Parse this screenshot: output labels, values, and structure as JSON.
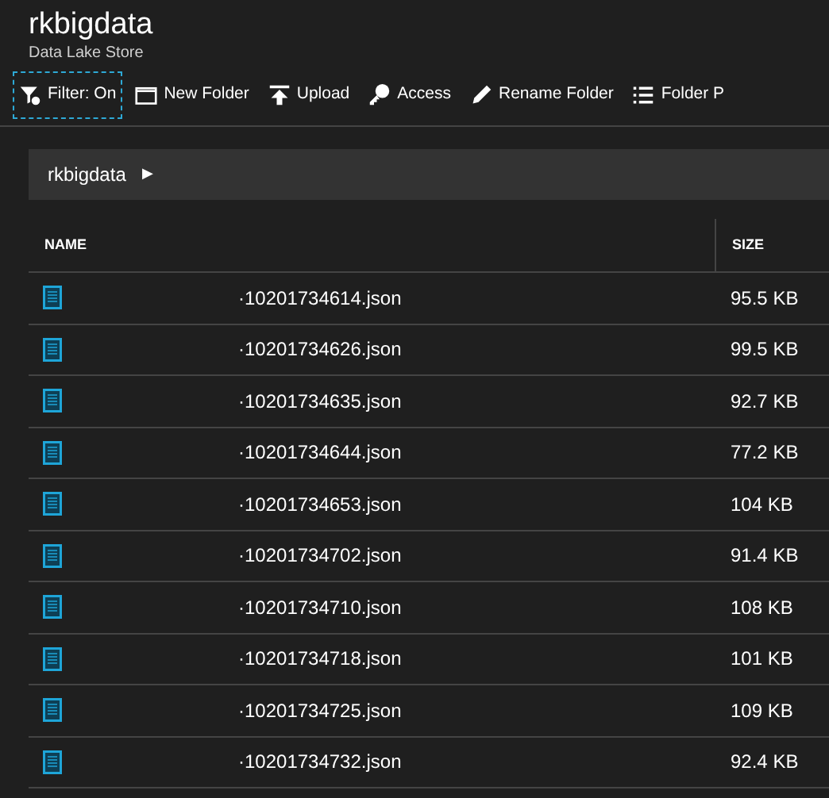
{
  "header": {
    "title": "rkbigdata",
    "subtitle": "Data Lake Store"
  },
  "toolbar": [
    {
      "kind": "filter",
      "label": "Filter: On",
      "focused": true
    },
    {
      "kind": "folder",
      "label": "New Folder",
      "focused": false
    },
    {
      "kind": "upload",
      "label": "Upload",
      "focused": false
    },
    {
      "kind": "key",
      "label": "Access",
      "focused": false
    },
    {
      "kind": "pencil",
      "label": "Rename Folder",
      "focused": false
    },
    {
      "kind": "list",
      "label": "Folder P",
      "focused": false
    }
  ],
  "breadcrumb": {
    "label": "rkbigdata",
    "arrow": "▶"
  },
  "table": {
    "columns": [
      "NAME",
      "SIZE"
    ],
    "rows": [
      {
        "name": "·10201734614.json",
        "size": "95.5 KB"
      },
      {
        "name": "·10201734626.json",
        "size": "99.5 KB"
      },
      {
        "name": "·10201734635.json",
        "size": "92.7 KB"
      },
      {
        "name": "·10201734644.json",
        "size": "77.2 KB"
      },
      {
        "name": "·10201734653.json",
        "size": "104 KB"
      },
      {
        "name": "·10201734702.json",
        "size": "91.4 KB"
      },
      {
        "name": "·10201734710.json",
        "size": "108 KB"
      },
      {
        "name": "·10201734718.json",
        "size": "101 KB"
      },
      {
        "name": "·10201734725.json",
        "size": "109 KB"
      },
      {
        "name": "·10201734732.json",
        "size": "92.4 KB"
      }
    ]
  }
}
